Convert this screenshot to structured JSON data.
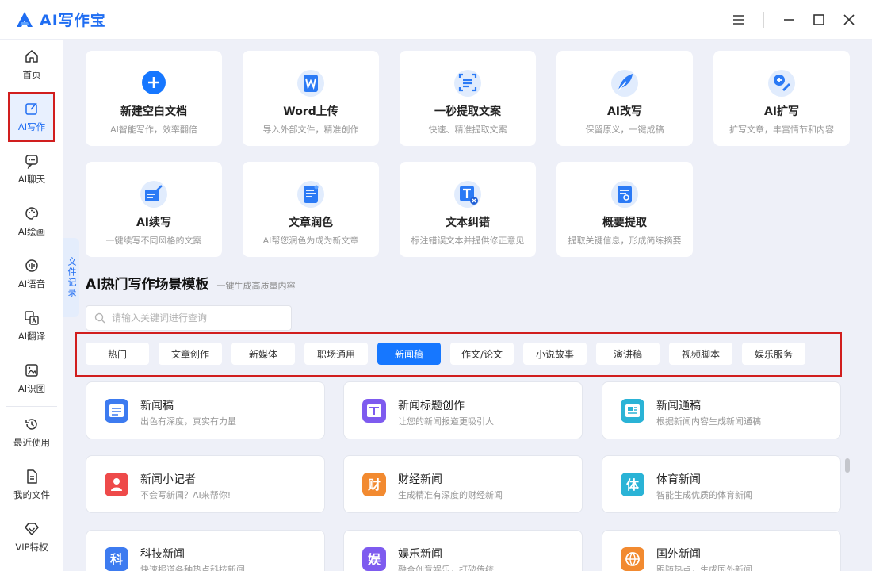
{
  "app": {
    "title": "AI写作宝",
    "brand_color": "#1f6df2"
  },
  "window": {
    "menu_icon": "hamburger-icon",
    "minimize_icon": "minimize-icon",
    "maximize_icon": "maximize-icon",
    "close_icon": "close-icon"
  },
  "sidebar": {
    "items": [
      {
        "label": "首页",
        "icon": "home-icon"
      },
      {
        "label": "AI写作",
        "icon": "edit-icon",
        "active": true
      },
      {
        "label": "AI聊天",
        "icon": "chat-icon"
      },
      {
        "label": "AI绘画",
        "icon": "palette-icon"
      },
      {
        "label": "AI语音",
        "icon": "voice-icon"
      },
      {
        "label": "AI翻译",
        "icon": "translate-icon"
      },
      {
        "label": "AI识图",
        "icon": "image-recognize-icon"
      },
      {
        "label": "最近使用",
        "icon": "history-icon"
      },
      {
        "label": "我的文件",
        "icon": "file-icon"
      },
      {
        "label": "VIP特权",
        "icon": "diamond-icon"
      }
    ]
  },
  "file_tab": {
    "label": "文件记录"
  },
  "tools": [
    {
      "title": "新建空白文档",
      "desc": "AI智能写作，效率翻倍",
      "icon": "plus-circle-icon"
    },
    {
      "title": "Word上传",
      "desc": "导入外部文件，精准创作",
      "icon": "word-icon"
    },
    {
      "title": "一秒提取文案",
      "desc": "快速、精准提取文案",
      "icon": "extract-icon"
    },
    {
      "title": "AI改写",
      "desc": "保留原义，一键成稿",
      "icon": "feather-icon"
    },
    {
      "title": "AI扩写",
      "desc": "扩写文章，丰富情节和内容",
      "icon": "expand-icon"
    },
    {
      "title": "AI续写",
      "desc": "一键续写不同风格的文案",
      "icon": "continue-icon"
    },
    {
      "title": "文章润色",
      "desc": "AI帮您润色为成为新文章",
      "icon": "polish-icon"
    },
    {
      "title": "文本纠错",
      "desc": "标注错误文本并提供修正意见",
      "icon": "text-correct-icon"
    },
    {
      "title": "概要提取",
      "desc": "提取关键信息，形成简练摘要",
      "icon": "summary-icon"
    }
  ],
  "templates": {
    "title": "AI热门写作场景模板",
    "subtitle": "一键生成高质量内容",
    "search_placeholder": "请输入关键词进行查询",
    "search_value": "",
    "categories": [
      {
        "label": "热门"
      },
      {
        "label": "文章创作"
      },
      {
        "label": "新媒体"
      },
      {
        "label": "职场通用"
      },
      {
        "label": "新闻稿",
        "active": true
      },
      {
        "label": "作文/论文"
      },
      {
        "label": "小说故事"
      },
      {
        "label": "演讲稿"
      },
      {
        "label": "视频脚本"
      },
      {
        "label": "娱乐服务"
      }
    ],
    "items": [
      {
        "title": "新闻稿",
        "desc": "出色有深度，真实有力量",
        "icon": "news-icon",
        "color": "#3d7bf0"
      },
      {
        "title": "新闻标题创作",
        "desc": "让您的新闻报道更吸引人",
        "icon": "title-icon",
        "color": "#7e5bef"
      },
      {
        "title": "新闻通稿",
        "desc": "根据新闻内容生成新闻通稿",
        "icon": "newspaper-icon",
        "color": "#2ab3d6"
      },
      {
        "title": "新闻小记者",
        "desc": "不会写新闻？AI来帮你!",
        "icon": "reporter-icon",
        "color": "#ee4a4a"
      },
      {
        "title": "财经新闻",
        "desc": "生成精准有深度的财经新闻",
        "icon": "finance-icon",
        "color": "#f28a30"
      },
      {
        "title": "体育新闻",
        "desc": "智能生成优质的体育新闻",
        "icon": "sports-icon",
        "color": "#2ab3d6"
      },
      {
        "title": "科技新闻",
        "desc": "快速报道各种热点科技新闻",
        "icon": "tech-icon",
        "color": "#3d7bf0"
      },
      {
        "title": "娱乐新闻",
        "desc": "融合创意娱乐，打破传统",
        "icon": "entertainment-icon",
        "color": "#7e5bef"
      },
      {
        "title": "国外新闻",
        "desc": "跟随热点，生成国外新闻",
        "icon": "globe-icon",
        "color": "#f28a30"
      }
    ]
  }
}
